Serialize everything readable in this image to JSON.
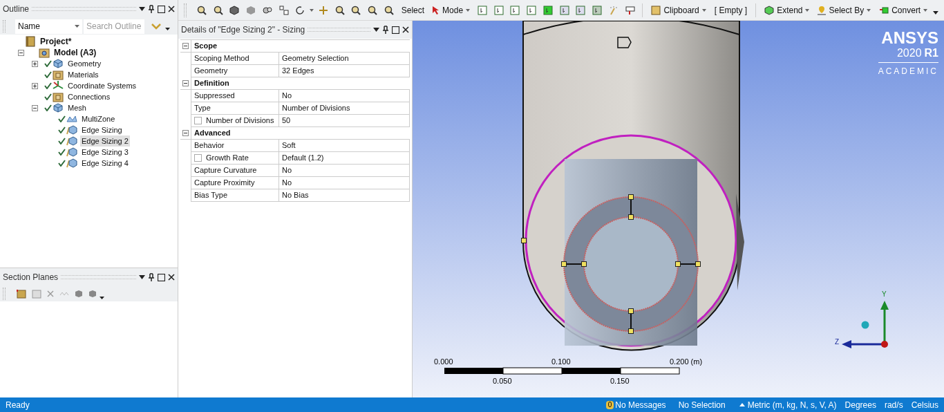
{
  "outline": {
    "title": "Outline",
    "filter": "Name",
    "search": {
      "placeholder": "Search Outline"
    },
    "tree": [
      {
        "label": "Project*",
        "kind": "project",
        "bold": true,
        "selected": false,
        "children": [
          {
            "label": "Model (A3)",
            "kind": "model",
            "bold": true,
            "selected": false,
            "expanded": true,
            "children": [
              {
                "label": "Geometry",
                "kind": "geometry",
                "ok": true,
                "selected": false,
                "expanded": false
              },
              {
                "label": "Materials",
                "kind": "folder",
                "ok": true,
                "selected": false
              },
              {
                "label": "Coordinate Systems",
                "kind": "coordinate",
                "ok": true,
                "selected": false,
                "expanded": false
              },
              {
                "label": "Connections",
                "kind": "folder",
                "ok": true,
                "selected": false
              },
              {
                "label": "Mesh",
                "kind": "geometry",
                "ok": true,
                "selected": false,
                "expanded": true,
                "children": [
                  {
                    "label": "MultiZone",
                    "kind": "multizone",
                    "ok": true,
                    "selected": false
                  },
                  {
                    "label": "Edge Sizing",
                    "kind": "sizing",
                    "ok": true,
                    "selected": false
                  },
                  {
                    "label": "Edge Sizing 2",
                    "kind": "sizing",
                    "ok": true,
                    "selected": true
                  },
                  {
                    "label": "Edge Sizing 3",
                    "kind": "sizing",
                    "ok": true,
                    "selected": false
                  },
                  {
                    "label": "Edge Sizing 4",
                    "kind": "sizing",
                    "ok": true,
                    "selected": false
                  }
                ]
              }
            ]
          }
        ]
      }
    ]
  },
  "section_planes": {
    "title": "Section Planes"
  },
  "toolbar": [
    {
      "label": "Select",
      "caret": false
    },
    {
      "label": "Mode",
      "caret": true
    },
    {
      "label": "Clipboard",
      "caret": true
    },
    {
      "label": "[ Empty ]",
      "caret": false
    },
    {
      "label": "Extend",
      "caret": true
    },
    {
      "label": "Select By",
      "caret": true
    },
    {
      "label": "Convert",
      "caret": true
    }
  ],
  "details": {
    "title": "Details of \"Edge Sizing 2\" - Sizing",
    "sections": [
      {
        "name": "Scope",
        "expanded": true,
        "rows": [
          {
            "label": "Scoping Method",
            "value": "Geometry Selection",
            "kind": "plain"
          },
          {
            "label": "Geometry",
            "value": "32 Edges",
            "kind": "plain"
          }
        ]
      },
      {
        "name": "Definition",
        "expanded": true,
        "rows": [
          {
            "label": "Suppressed",
            "value": "No",
            "kind": "plain"
          },
          {
            "label": "Type",
            "value": "Number of Divisions",
            "kind": "plain"
          },
          {
            "label": "Number of Divisions",
            "value": "50",
            "kind": "parameter",
            "checked": false
          }
        ]
      },
      {
        "name": "Advanced",
        "expanded": true,
        "rows": [
          {
            "label": "Behavior",
            "value": "Soft",
            "kind": "plain"
          },
          {
            "label": "Growth Rate",
            "value": "Default (1.2)",
            "kind": "parameter",
            "checked": false
          },
          {
            "label": "Capture Curvature",
            "value": "No",
            "kind": "plain"
          },
          {
            "label": "Capture Proximity",
            "value": "No",
            "kind": "plain"
          },
          {
            "label": "Bias Type",
            "value": "No Bias",
            "kind": "plain"
          }
        ]
      }
    ]
  },
  "viewport": {
    "logo": {
      "brand": "ANSYS",
      "version": "2020",
      "release": "R1",
      "edition": "ACADEMIC"
    },
    "scale": {
      "top_labels": [
        "0.000",
        "0.100",
        "0.200"
      ],
      "unit": "(m)",
      "bottom_labels": [
        "0.050",
        "0.150"
      ]
    },
    "axes": {
      "vertical": "Y",
      "horizontal": "Z"
    }
  },
  "status_bar": {
    "left": "Ready",
    "message_count": "0",
    "items": [
      "No Messages",
      "No Selection",
      "Metric (m, kg, N, s, V, A)",
      "Degrees",
      "rad/s",
      "Celsius"
    ]
  }
}
